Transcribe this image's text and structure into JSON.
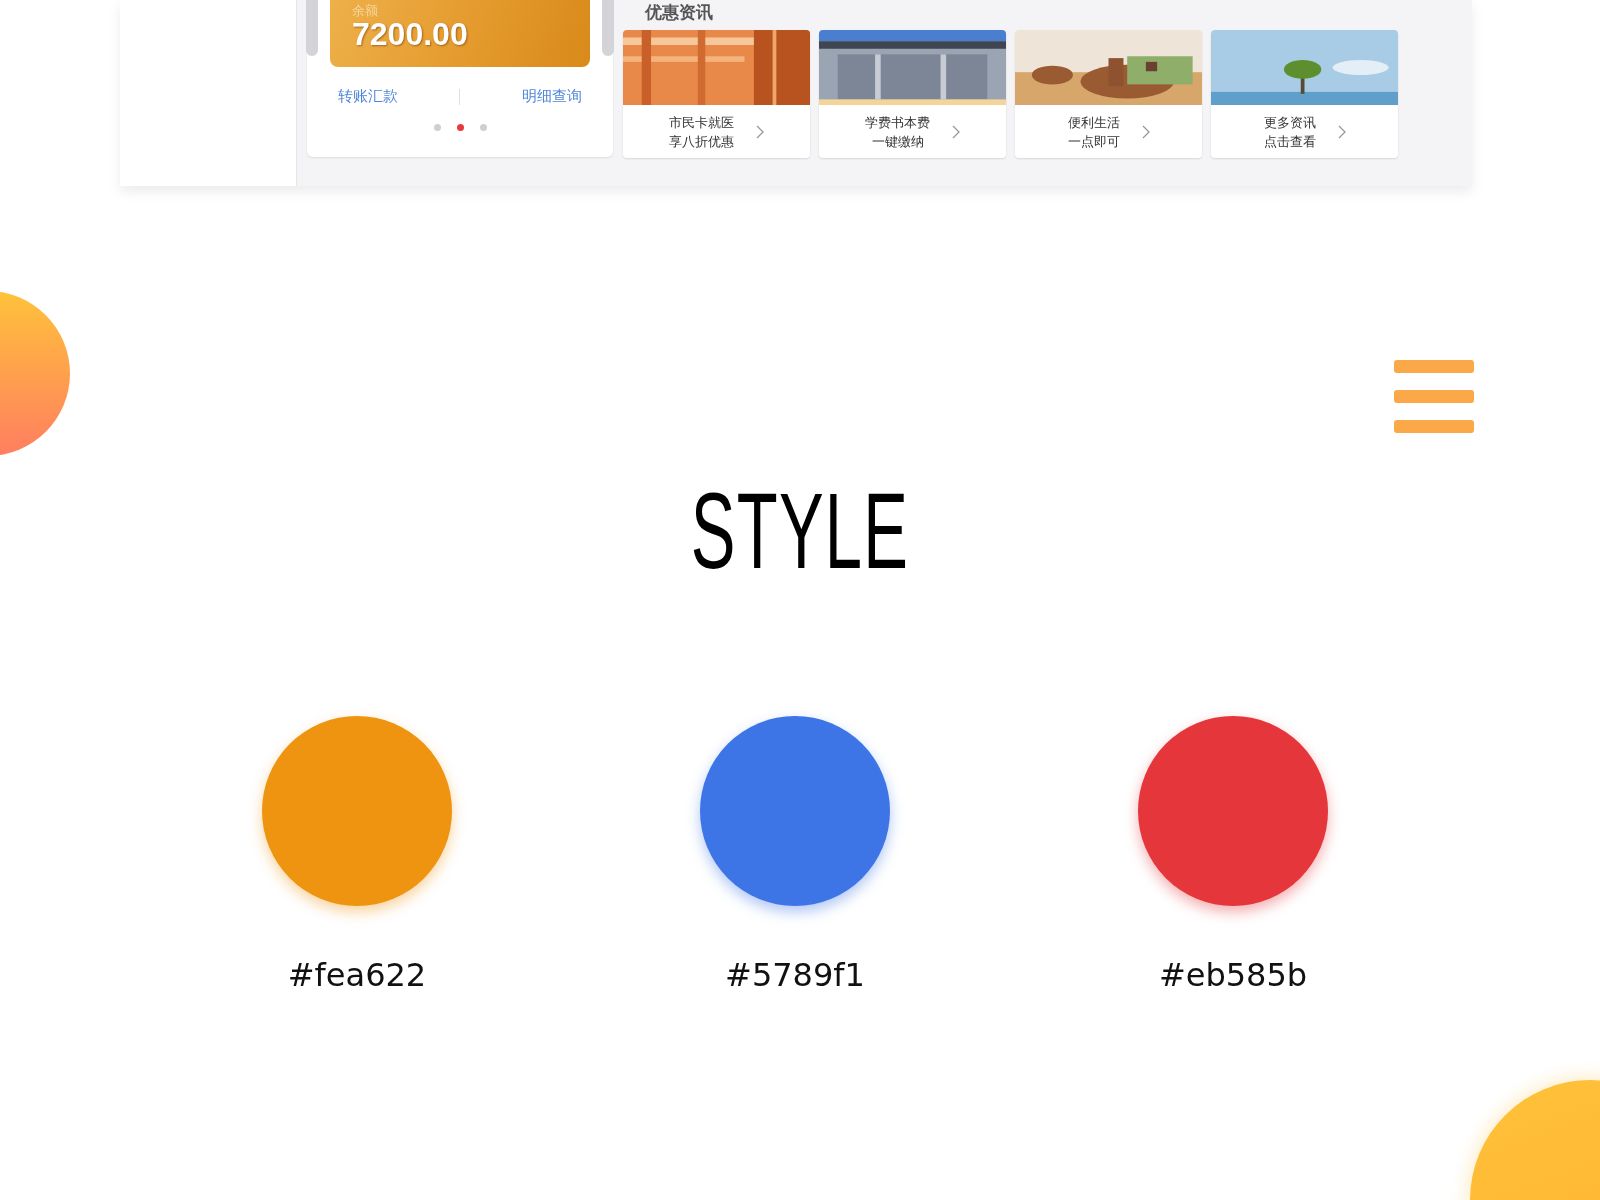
{
  "balance_card": {
    "label": "余额",
    "amount": "7200.00",
    "actions": [
      "转账汇款",
      "明细查询"
    ],
    "dots": [
      {
        "selected": false
      },
      {
        "selected": true
      },
      {
        "selected": false
      }
    ]
  },
  "news": {
    "title": "优惠资讯",
    "items": [
      {
        "lines": [
          "市民卡就医",
          "享八折优惠"
        ],
        "kind": "picture"
      },
      {
        "lines": [
          "学费书本费",
          "一键缴纳"
        ],
        "kind": "picture"
      },
      {
        "lines": [
          "便利生活",
          "一点即可"
        ],
        "kind": "picture"
      },
      {
        "lines": [
          "更多资讯",
          "点击查看"
        ],
        "kind": "picture"
      }
    ]
  },
  "style": {
    "title": "STYLE",
    "swatches": [
      {
        "label": "#fea622",
        "color": "#ee9410"
      },
      {
        "label": "#5789f1",
        "color": "#3d74e6"
      },
      {
        "label": "#eb585b",
        "color": "#e4363b"
      }
    ]
  }
}
